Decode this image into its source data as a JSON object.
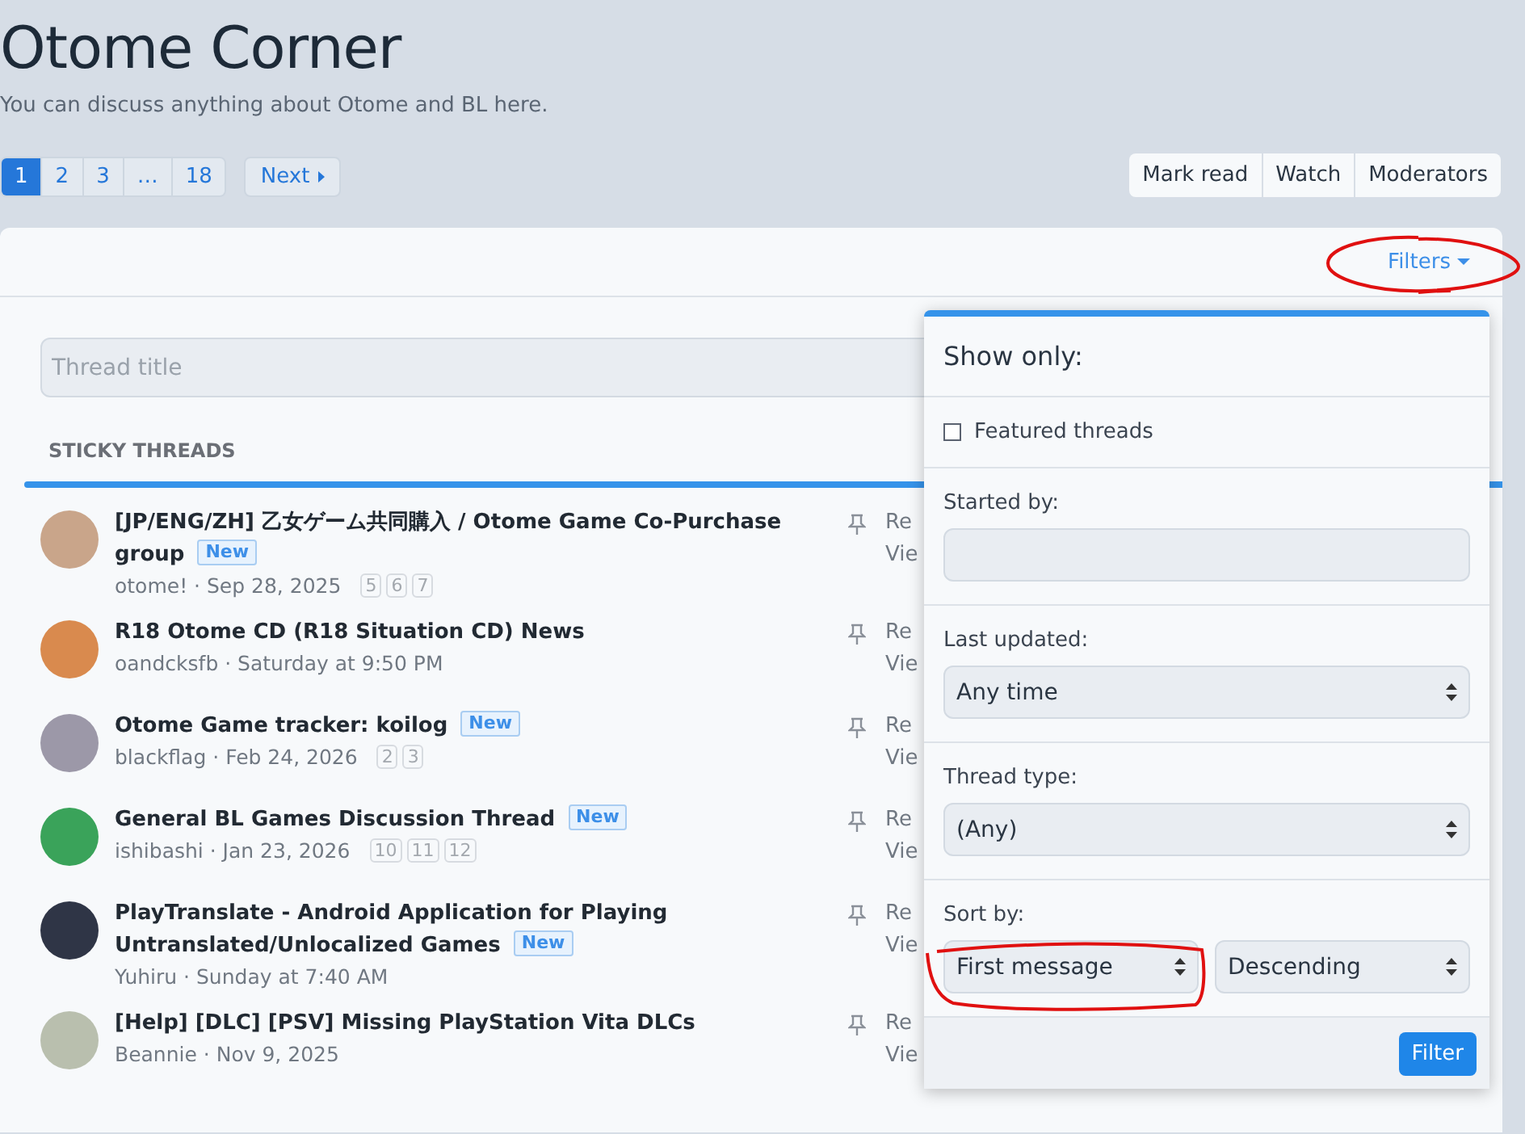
{
  "header": {
    "title": "Otome Corner",
    "description": "You can discuss anything about Otome and BL here."
  },
  "pagination": {
    "pages": [
      {
        "label": "1",
        "selected": true
      },
      {
        "label": "2",
        "selected": false
      },
      {
        "label": "3",
        "selected": false
      },
      {
        "label": "…",
        "selected": false
      },
      {
        "label": "18",
        "selected": false
      }
    ],
    "next": "Next"
  },
  "actions": [
    "Mark read",
    "Watch",
    "Moderators"
  ],
  "filters_toggle": "Filters",
  "search": {
    "placeholder": "Thread title"
  },
  "section_title": "STICKY THREADS",
  "threads": [
    {
      "title": "[JP/ENG/ZH] 乙女ゲーム共同購入 / Otome Game Co-Purchase group",
      "tag": "New",
      "meta": "otome! · Sep 28, 2025",
      "pages": [
        "5",
        "6",
        "7"
      ],
      "stat_1": "Re",
      "stat_2": "Vie"
    },
    {
      "title": "R18 Otome CD (R18 Situation CD) News",
      "meta": "oandcksfb · Saturday at 9:50 PM",
      "stat_1": "Re",
      "stat_2": "Vie"
    },
    {
      "title": "Otome Game tracker: koilog",
      "tag": "New",
      "meta": "blackflag · Feb 24, 2026",
      "pages": [
        "2",
        "3"
      ],
      "stat_1": "Re",
      "stat_2": "Vie"
    },
    {
      "title": "General BL Games Discussion Thread",
      "tag": "New",
      "meta": "ishibashi · Jan 23, 2026",
      "pages": [
        "10",
        "11",
        "12"
      ],
      "stat_1": "Re",
      "stat_2": "Vie"
    },
    {
      "title": "PlayTranslate - Android Application for Playing Untranslated/Unlocalized Games",
      "tag": "New",
      "meta": "Yuhiru · Sunday at 7:40 AM",
      "stat_1": "Re",
      "stat_2": "Vie"
    },
    {
      "title": "[Help] [DLC] [PSV] Missing PlayStation Vita DLCs",
      "meta": "Beannie · Nov 9, 2025",
      "stat_1": "Re",
      "stat_2": "Vie"
    }
  ],
  "filter_menu": {
    "heading": "Show only:",
    "featured": {
      "label": "Featured threads",
      "checked": false
    },
    "started_by": {
      "label": "Started by:"
    },
    "last_updated": {
      "label": "Last updated:",
      "value": "Any time"
    },
    "thread_type": {
      "label": "Thread type:",
      "value": "(Any)"
    },
    "sort_by": {
      "label": "Sort by:",
      "field": "First message",
      "order": "Descending"
    },
    "submit": "Filter"
  }
}
